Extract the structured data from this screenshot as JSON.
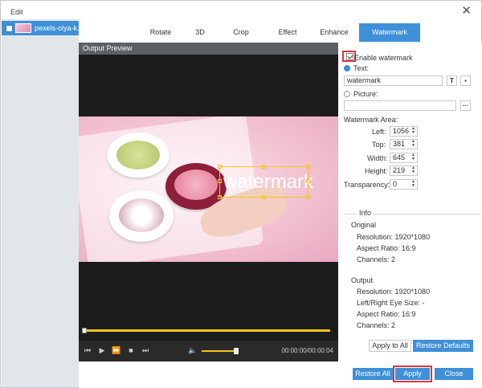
{
  "window": {
    "title": "Edit",
    "close_icon": "close-icon"
  },
  "sidebar": {
    "items": [
      {
        "label": "pexels-olya-k..."
      }
    ]
  },
  "tabs": [
    {
      "label": "Rotate"
    },
    {
      "label": "3D"
    },
    {
      "label": "Crop"
    },
    {
      "label": "Effect"
    },
    {
      "label": "Enhance"
    },
    {
      "label": "Watermark",
      "active": true
    }
  ],
  "preview": {
    "header": "Output Preview",
    "watermark_text": "watermark",
    "time": "00:00:00/00:00:04"
  },
  "watermark": {
    "enable_label": "Enable watermark",
    "text_label": "Text:",
    "text_value": "watermark",
    "picture_label": "Picture:",
    "picture_value": "",
    "browse_label": "···",
    "area_label": "Watermark Area:",
    "left_label": "Left:",
    "left_value": "1056",
    "top_label": "Top:",
    "top_value": "381",
    "width_label": "Width:",
    "width_value": "645",
    "height_label": "Height:",
    "height_value": "219",
    "transparency_label": "Transparency:",
    "transparency_value": "0"
  },
  "info": {
    "title": "Info",
    "original_label": "Original",
    "orig_resolution": "Resolution: 1920*1080",
    "orig_aspect": "Aspect Ratio: 16:9",
    "orig_channels": "Channels: 2",
    "output_label": "Output",
    "out_resolution": "Resolution: 1920*1080",
    "out_eye_size": "Left/Right Eye Size: -",
    "out_aspect": "Aspect Ratio: 16:9",
    "out_channels": "Channels: 2"
  },
  "buttons": {
    "apply_to_all": "Apply to All",
    "restore_defaults": "Restore Defaults",
    "restore_all": "Restore All",
    "apply": "Apply",
    "close": "Close"
  },
  "colors": {
    "accent": "#3e90d9",
    "highlight": "#d9363e",
    "watermark_frame": "#f5c518"
  }
}
